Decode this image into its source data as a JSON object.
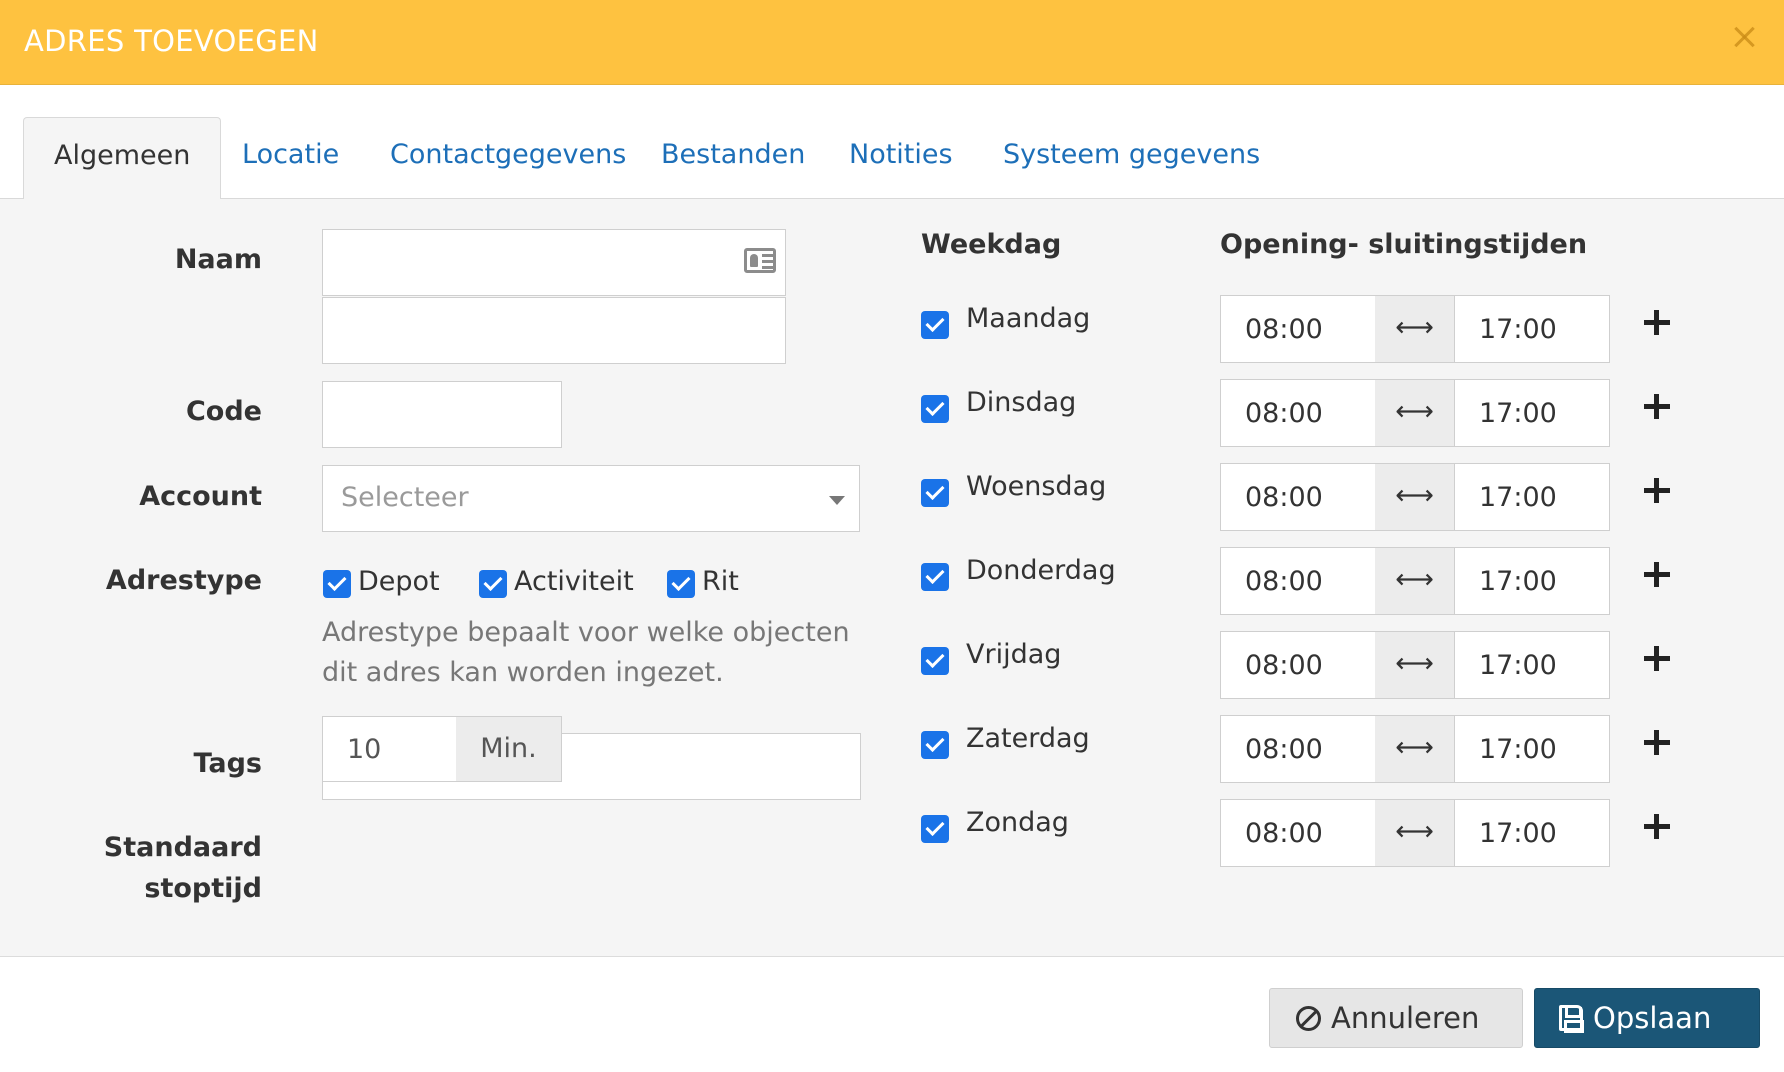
{
  "header": {
    "title": "ADRES TOEVOEGEN"
  },
  "tabs": [
    {
      "label": "Algemeen",
      "active": true
    },
    {
      "label": "Locatie"
    },
    {
      "label": "Contactgegevens"
    },
    {
      "label": "Bestanden"
    },
    {
      "label": "Notities"
    },
    {
      "label": "Systeem gegevens"
    }
  ],
  "form": {
    "naam_label": "Naam",
    "code_label": "Code",
    "account_label": "Account",
    "account_placeholder": "Selecteer",
    "adrestype_label": "Adrestype",
    "adrestypes": [
      {
        "label": "Depot",
        "checked": true
      },
      {
        "label": "Activiteit",
        "checked": true
      },
      {
        "label": "Rit",
        "checked": true
      }
    ],
    "adrestype_help": "Adrestype bepaalt voor welke objecten dit adres kan worden ingezet.",
    "tags_label": "Tags",
    "stoptijd_label_1": "Standaard",
    "stoptijd_label_2": "stoptijd",
    "stoptijd_value": "10",
    "stoptijd_unit": "Min."
  },
  "schedule": {
    "weekday_header": "Weekdag",
    "hours_header": "Opening- sluitingstijden",
    "separator": "⟷",
    "days": [
      {
        "label": "Maandag",
        "checked": true,
        "open": "08:00",
        "close": "17:00"
      },
      {
        "label": "Dinsdag",
        "checked": true,
        "open": "08:00",
        "close": "17:00"
      },
      {
        "label": "Woensdag",
        "checked": true,
        "open": "08:00",
        "close": "17:00"
      },
      {
        "label": "Donderdag",
        "checked": true,
        "open": "08:00",
        "close": "17:00"
      },
      {
        "label": "Vrijdag",
        "checked": true,
        "open": "08:00",
        "close": "17:00"
      },
      {
        "label": "Zaterdag",
        "checked": true,
        "open": "08:00",
        "close": "17:00"
      },
      {
        "label": "Zondag",
        "checked": true,
        "open": "08:00",
        "close": "17:00"
      }
    ]
  },
  "footer": {
    "cancel_label": "Annuleren",
    "save_label": "Opslaan"
  },
  "colors": {
    "header_bg": "#fec240",
    "accent_blue": "#1a73e8",
    "link_blue": "#1d6fb8",
    "save_bg": "#1b5677"
  }
}
